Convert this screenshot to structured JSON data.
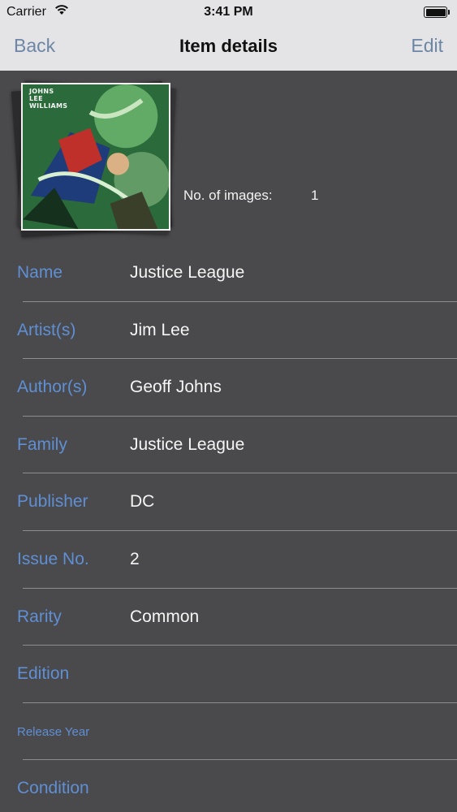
{
  "status_bar": {
    "carrier": "Carrier",
    "time": "3:41 PM",
    "wifi_icon": "wifi-icon",
    "battery_icon": "battery-icon"
  },
  "nav": {
    "back_label": "Back",
    "title": "Item details",
    "edit_label": "Edit"
  },
  "images": {
    "count_label": "No. of images:",
    "count_value": "1",
    "cover_credits": [
      "JOHNS",
      "LEE",
      "WILLIAMS"
    ]
  },
  "fields": [
    {
      "label": "Name",
      "value": "Justice League"
    },
    {
      "label": "Artist(s)",
      "value": "Jim Lee"
    },
    {
      "label": "Author(s)",
      "value": "Geoff Johns"
    },
    {
      "label": "Family",
      "value": "Justice League"
    },
    {
      "label": "Publisher",
      "value": "DC"
    },
    {
      "label": "Issue No.",
      "value": "2"
    },
    {
      "label": "Rarity",
      "value": "Common"
    },
    {
      "label": "Edition",
      "value": ""
    },
    {
      "label": "Release Year",
      "value": ""
    },
    {
      "label": "Condition",
      "value": ""
    }
  ],
  "colors": {
    "background": "#4a494b",
    "bar_background": "#e4e4e6",
    "label_blue": "#5f8fd4",
    "nav_button": "#6d86a6",
    "value_text": "#f5f5f5"
  }
}
